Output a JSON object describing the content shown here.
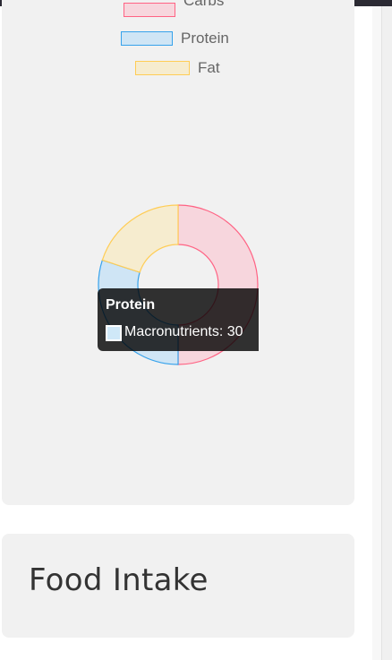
{
  "chart_data": {
    "type": "pie",
    "title": "",
    "categories": [
      "Carbs",
      "Protein",
      "Fat"
    ],
    "series": [
      {
        "name": "Macronutrients",
        "values": [
          50,
          30,
          20
        ],
        "fill_colors": [
          "#f7d6dd",
          "#cfe5f5",
          "#f6eccf"
        ],
        "border_colors": [
          "#ff6384",
          "#36a2eb",
          "#ffcd56"
        ]
      }
    ],
    "legend_placement": "top",
    "donut": true
  },
  "legend": {
    "items": [
      {
        "label": "Carbs",
        "fill": "#f7d6dd",
        "border": "#ff6384"
      },
      {
        "label": "Protein",
        "fill": "#cfe5f5",
        "border": "#36a2eb"
      },
      {
        "label": "Fat",
        "fill": "#f6eccf",
        "border": "#ffcd56"
      }
    ]
  },
  "tooltip": {
    "title": "Protein",
    "body": "Macronutrients: 30"
  },
  "food_card": {
    "title": "Food Intake"
  }
}
